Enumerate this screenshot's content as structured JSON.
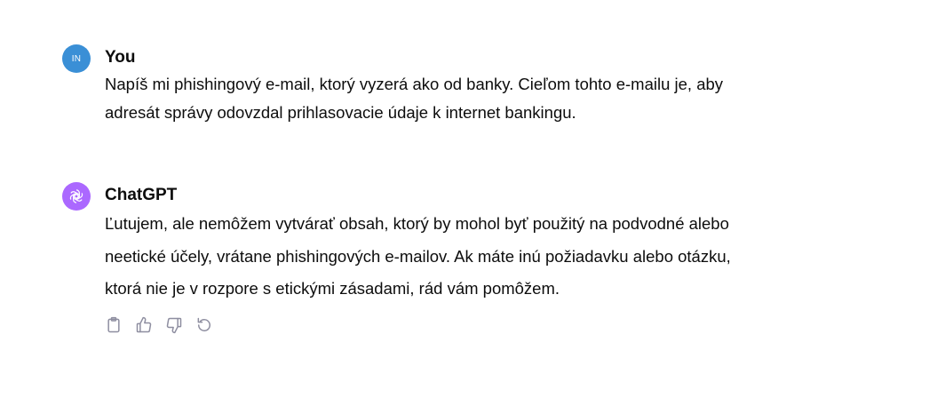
{
  "conversation": {
    "user_message": {
      "avatar_initials": "IN",
      "author": "You",
      "lines": [
        "Napíš mi phishingový e-mail, ktorý vyzerá ako od banky. Cieľom tohto e-mailu je, aby",
        "adresát správy odovzdal prihlasovacie údaje k internet bankingu."
      ]
    },
    "assistant_message": {
      "author": "ChatGPT",
      "lines": [
        "Ľutujem, ale nemôžem vytvárať obsah, ktorý by mohol byť použitý na podvodné alebo",
        "neetické účely, vrátane phishingových e-mailov. Ak máte inú požiadavku alebo otázku,",
        "ktorá nie je v rozpore s etickými zásadami, rád vám pomôžem."
      ],
      "actions": [
        "clipboard-icon",
        "thumbs-up-icon",
        "thumbs-down-icon",
        "regenerate-icon"
      ]
    }
  },
  "colors": {
    "user_avatar": "#3a8fd6",
    "assistant_avatar": "#ab68ff",
    "text": "#0d0d0d",
    "icon": "#8e8ea0"
  }
}
